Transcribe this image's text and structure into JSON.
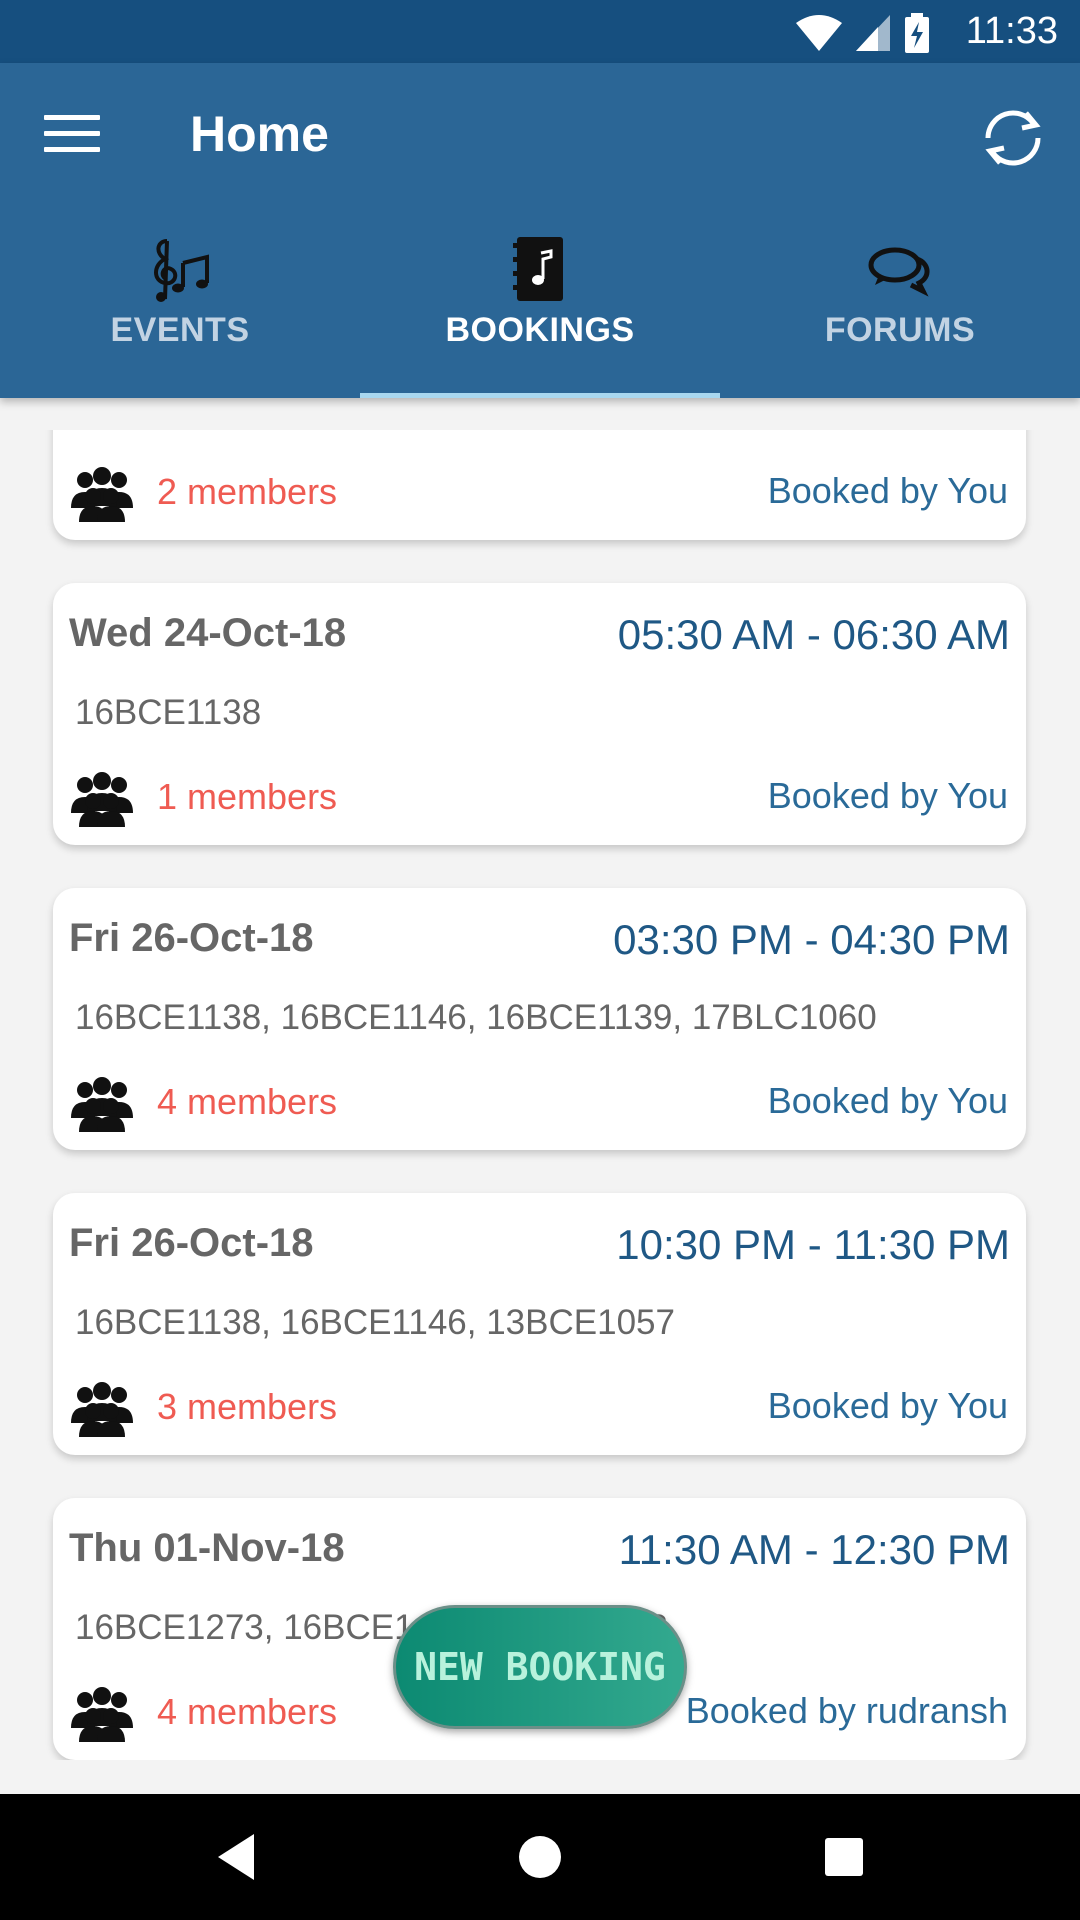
{
  "status_bar": {
    "time": "11:33",
    "icons": [
      "wifi-icon",
      "signal-icon",
      "battery-charging-icon"
    ]
  },
  "app_bar": {
    "title": "Home",
    "menu_icon": "menu-icon",
    "refresh_icon": "refresh-icon"
  },
  "tabs": [
    {
      "label": "EVENTS",
      "icon": "music-notes-icon",
      "active": false
    },
    {
      "label": "BOOKINGS",
      "icon": "music-book-icon",
      "active": true
    },
    {
      "label": "FORUMS",
      "icon": "chat-bubbles-icon",
      "active": false
    }
  ],
  "bookings": [
    {
      "date": "",
      "time": "",
      "ids": "",
      "members": "2 members",
      "booked_by": "Booked by You"
    },
    {
      "date": "Wed 24-Oct-18",
      "time": "05:30 AM - 06:30 AM",
      "ids": "16BCE1138",
      "members": "1 members",
      "booked_by": "Booked by You"
    },
    {
      "date": "Fri 26-Oct-18",
      "time": "03:30 PM - 04:30 PM",
      "ids": "16BCE1138, 16BCE1146, 16BCE1139, 17BLC1060",
      "members": "4 members",
      "booked_by": "Booked by You"
    },
    {
      "date": "Fri 26-Oct-18",
      "time": "10:30 PM - 11:30 PM",
      "ids": "16BCE1138, 16BCE1146, 13BCE1057",
      "members": "3 members",
      "booked_by": "Booked by You"
    },
    {
      "date": "Thu 01-Nov-18",
      "time": "11:30 AM - 12:30 PM",
      "ids": "16BCE1273, 16BCE1...5, 16BCE1138",
      "members": "4 members",
      "booked_by": "Booked by rudransh"
    }
  ],
  "fab": {
    "label": "NEW BOOKING"
  },
  "nav_bar": {
    "buttons": [
      "back-icon",
      "home-icon",
      "recents-icon"
    ]
  },
  "colors": {
    "status_bar": "#164f7f",
    "app_bar": "#2b6696",
    "tab_indicator": "#a9d8f0",
    "members_text": "#ef5b52",
    "booked_by_text": "#2a6a98",
    "time_text": "#1f5885",
    "fab": "#0c8a72"
  }
}
